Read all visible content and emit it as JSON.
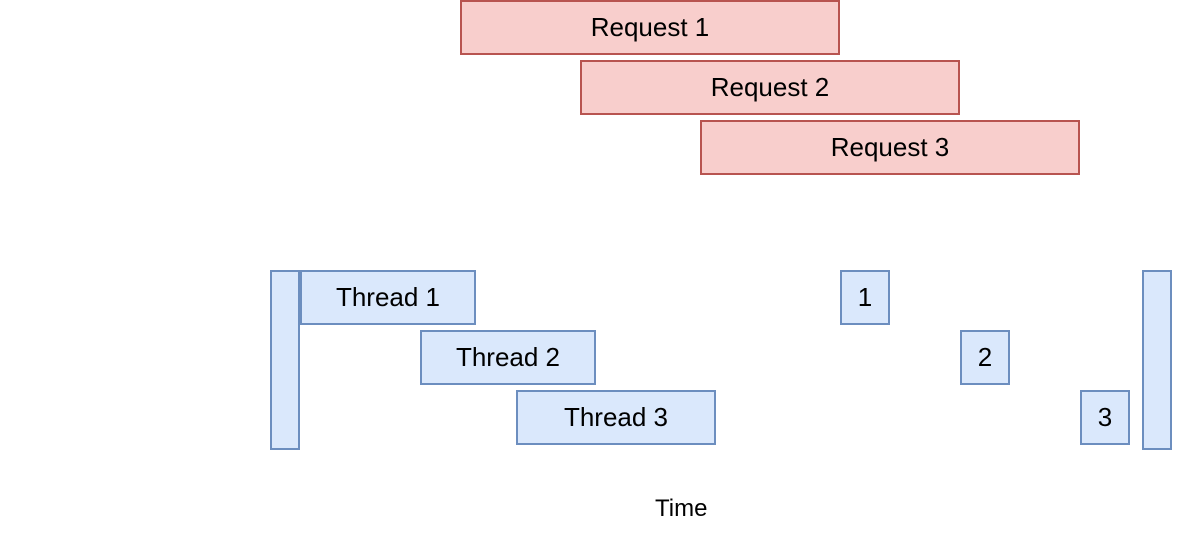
{
  "chart_data": {
    "type": "gantt",
    "title": "",
    "xlabel": "Time",
    "ylabel": "",
    "series": [
      {
        "name": "Request 1",
        "row": 0,
        "group": "request",
        "segments": [
          {
            "start": 460,
            "end": 840,
            "label": "Request 1"
          }
        ]
      },
      {
        "name": "Request 2",
        "row": 1,
        "group": "request",
        "segments": [
          {
            "start": 580,
            "end": 960,
            "label": "Request 2"
          }
        ]
      },
      {
        "name": "Request 3",
        "row": 2,
        "group": "request",
        "segments": [
          {
            "start": 700,
            "end": 1080,
            "label": "Request 3"
          }
        ]
      },
      {
        "name": "Thread 1",
        "row": 3,
        "group": "thread",
        "segments": [
          {
            "start": 300,
            "end": 476,
            "label": "Thread 1"
          },
          {
            "start": 840,
            "end": 890,
            "label": "1"
          }
        ]
      },
      {
        "name": "Thread 2",
        "row": 4,
        "group": "thread",
        "segments": [
          {
            "start": 420,
            "end": 596,
            "label": "Thread 2"
          },
          {
            "start": 960,
            "end": 1010,
            "label": "2"
          }
        ]
      },
      {
        "name": "Thread 3",
        "row": 5,
        "group": "thread",
        "segments": [
          {
            "start": 516,
            "end": 716,
            "label": "Thread 3"
          },
          {
            "start": 1080,
            "end": 1130,
            "label": "3"
          }
        ]
      },
      {
        "name": "Server start",
        "row": -1,
        "group": "server",
        "segments": [
          {
            "start": 270,
            "end": 300,
            "label": ""
          }
        ]
      },
      {
        "name": "Server end",
        "row": -1,
        "group": "server",
        "segments": [
          {
            "start": 1142,
            "end": 1172,
            "label": ""
          }
        ]
      }
    ]
  },
  "requests": [
    {
      "label": "Request 1"
    },
    {
      "label": "Request 2"
    },
    {
      "label": "Request 3"
    }
  ],
  "threads_long": [
    {
      "label": "Thread 1"
    },
    {
      "label": "Thread 2"
    },
    {
      "label": "Thread 3"
    }
  ],
  "threads_short": [
    {
      "label": "1"
    },
    {
      "label": "2"
    },
    {
      "label": "3"
    }
  ],
  "axis_label": "Time"
}
